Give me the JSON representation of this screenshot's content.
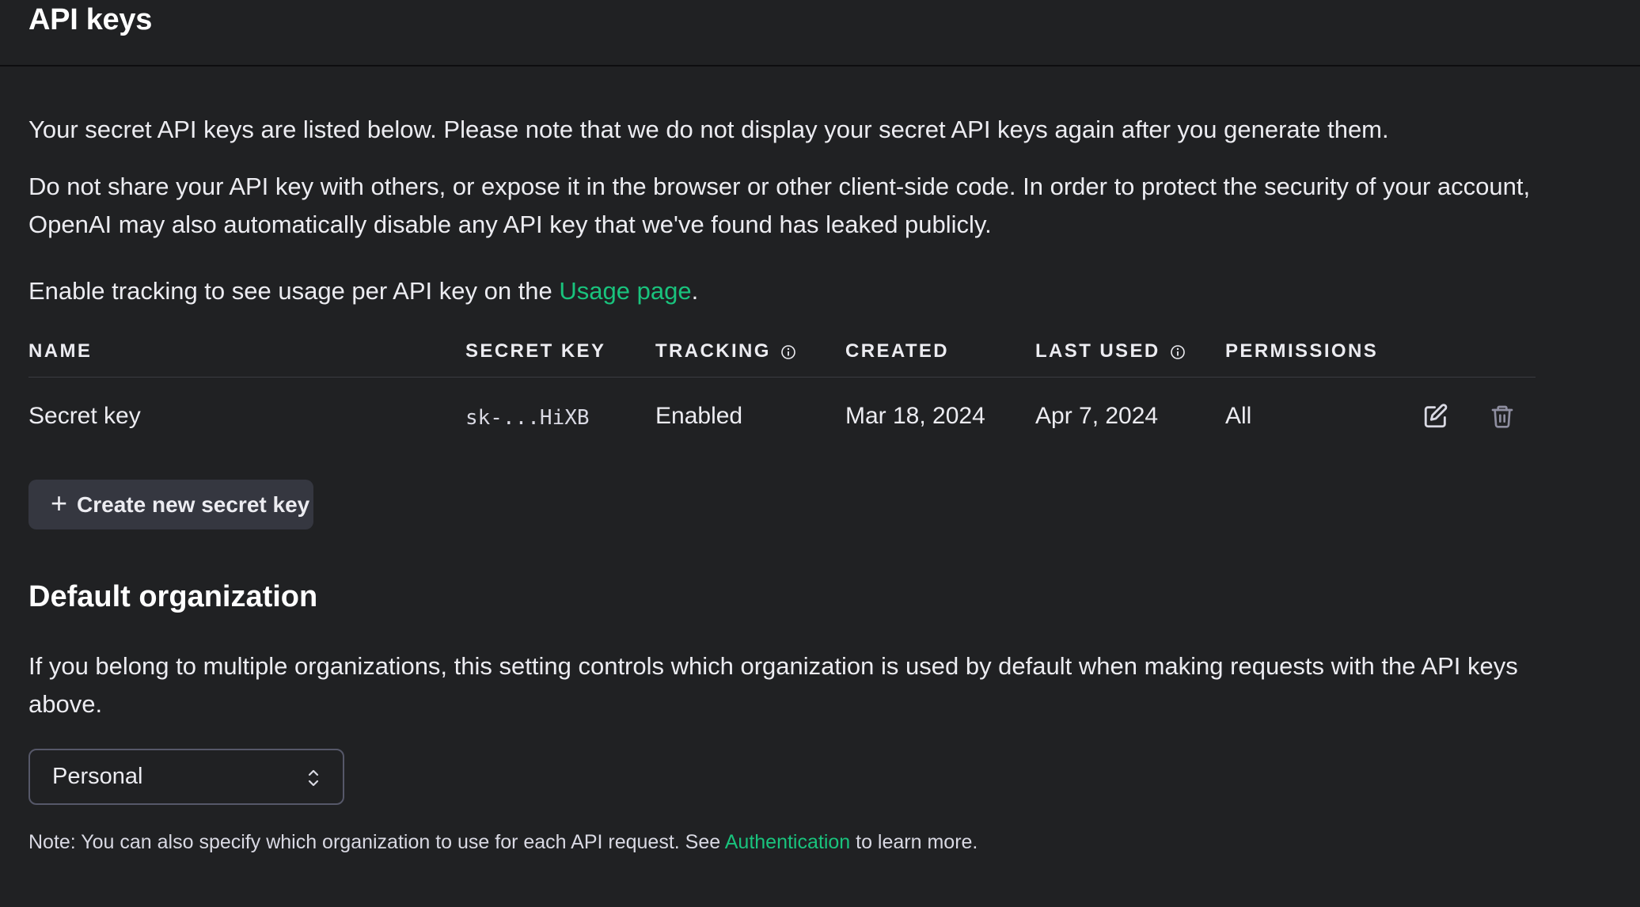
{
  "header": {
    "title": "API keys"
  },
  "intro": {
    "line1": "Your secret API keys are listed below. Please note that we do not display your secret API keys again after you generate them.",
    "line2": "Do not share your API key with others, or expose it in the browser or other client-side code. In order to protect the security of your account, OpenAI may also automatically disable any API key that we've found has leaked publicly.",
    "tracking_prefix": "Enable tracking to see usage per API key on the ",
    "tracking_link": "Usage page",
    "tracking_suffix": "."
  },
  "table": {
    "columns": [
      "NAME",
      "SECRET KEY",
      "TRACKING",
      "CREATED",
      "LAST USED",
      "PERMISSIONS"
    ],
    "rows": [
      {
        "name": "Secret key",
        "secret_key": "sk-...HiXB",
        "tracking": "Enabled",
        "created": "Mar 18, 2024",
        "last_used": "Apr 7, 2024",
        "permissions": "All"
      }
    ]
  },
  "create_button": {
    "icon": "plus-icon",
    "label": "Create new secret key"
  },
  "default_org": {
    "title": "Default organization",
    "description": "If you belong to multiple organizations, this setting controls which organization is used by default when making requests with the API keys above.",
    "selected": "Personal",
    "note_prefix": "Note: You can also specify which organization to use for each API request. See ",
    "note_link": "Authentication",
    "note_suffix": " to learn more."
  },
  "colors": {
    "background": "#202123",
    "accent": "#19c37d",
    "button": "#353740"
  }
}
